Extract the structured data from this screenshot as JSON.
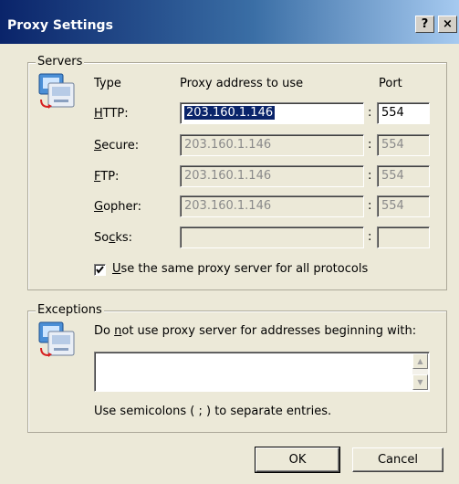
{
  "window": {
    "title": "Proxy Settings",
    "help_label": "?",
    "close_label": "×"
  },
  "servers": {
    "legend": "Servers",
    "icon": "network-computers-icon",
    "headers": {
      "type": "Type",
      "address": "Proxy address to use",
      "port": "Port"
    },
    "rows": [
      {
        "label_key": "H",
        "label_rest": "TTP:",
        "address": "203.160.1.146",
        "port": "554",
        "enabled": true,
        "selected": true
      },
      {
        "label_key": "S",
        "label_rest": "ecure:",
        "address": "203.160.1.146",
        "port": "554",
        "enabled": false
      },
      {
        "label_key": "F",
        "label_rest": "TP:",
        "address": "203.160.1.146",
        "port": "554",
        "enabled": false
      },
      {
        "label_key": "G",
        "label_rest": "opher:",
        "address": "203.160.1.146",
        "port": "554",
        "enabled": false
      },
      {
        "label_pre": "So",
        "label_key": "c",
        "label_rest": "ks:",
        "address": "",
        "port": "",
        "enabled": false
      }
    ],
    "colon": ":",
    "same_proxy": {
      "checked": true,
      "label_key": "U",
      "label_rest": "se the same proxy server for all protocols"
    }
  },
  "exceptions": {
    "legend": "Exceptions",
    "icon": "network-computers-icon",
    "instruction_pre": "Do ",
    "instruction_key": "n",
    "instruction_rest": "ot use proxy server for addresses beginning with:",
    "value": "",
    "hint": "Use semicolons ( ; ) to separate entries."
  },
  "buttons": {
    "ok": "OK",
    "cancel": "Cancel"
  }
}
